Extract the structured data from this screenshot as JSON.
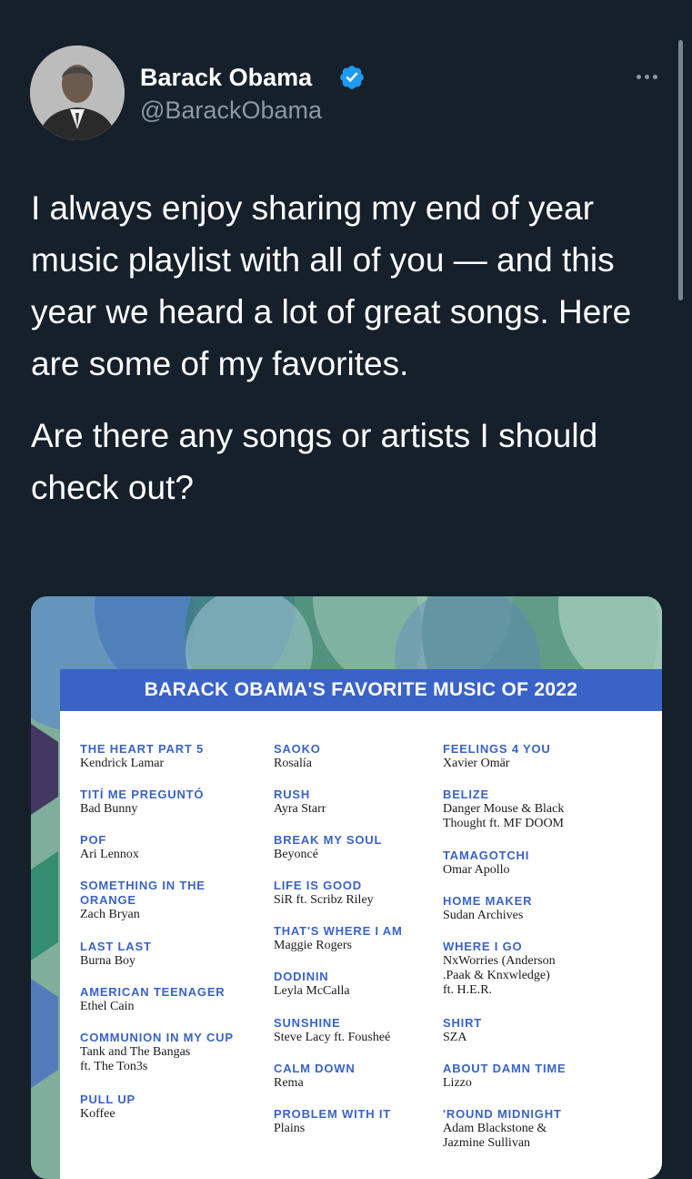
{
  "tweet": {
    "author": {
      "name": "Barack Obama",
      "handle": "@BarackObama",
      "verified": true
    },
    "paragraphs": [
      "I always enjoy sharing my end of year music playlist with all of you — and this year we heard a lot of great songs. Here are some of my favorites.",
      "Are there any songs or artists I should check out?"
    ],
    "more_icon": "more-horizontal-icon"
  },
  "image": {
    "title": "BARACK OBAMA'S FAVORITE MUSIC OF 2022",
    "columns": [
      [
        {
          "title": "THE HEART PART 5",
          "artist": "Kendrick Lamar"
        },
        {
          "title": "TITÍ ME PREGUNTÓ",
          "artist": "Bad Bunny"
        },
        {
          "title": "POF",
          "artist": "Ari Lennox"
        },
        {
          "title": "SOMETHING IN THE\nORANGE",
          "artist": "Zach Bryan"
        },
        {
          "title": "LAST LAST",
          "artist": "Burna Boy"
        },
        {
          "title": "AMERICAN TEENAGER",
          "artist": "Ethel Cain"
        },
        {
          "title": "COMMUNION IN MY CUP",
          "artist": "Tank and The Bangas\nft. The Ton3s"
        },
        {
          "title": "PULL UP",
          "artist": "Koffee"
        }
      ],
      [
        {
          "title": "SAOKO",
          "artist": "Rosalía"
        },
        {
          "title": "RUSH",
          "artist": "Ayra Starr"
        },
        {
          "title": "BREAK MY SOUL",
          "artist": "Beyoncé"
        },
        {
          "title": "LIFE IS GOOD",
          "artist": "SiR ft. Scribz Riley"
        },
        {
          "title": "THAT'S WHERE I AM",
          "artist": "Maggie Rogers"
        },
        {
          "title": "DODININ",
          "artist": "Leyla McCalla"
        },
        {
          "title": "SUNSHINE",
          "artist": "Steve Lacy ft. Fousheé"
        },
        {
          "title": "CALM DOWN",
          "artist": "Rema"
        },
        {
          "title": "PROBLEM WITH IT",
          "artist": "Plains"
        }
      ],
      [
        {
          "title": "FEELINGS 4 YOU",
          "artist": "Xavier Omär"
        },
        {
          "title": "BELIZE",
          "artist": "Danger Mouse & Black\nThought ft. MF DOOM"
        },
        {
          "title": "TAMAGOTCHI",
          "artist": "Omar Apollo"
        },
        {
          "title": "HOME MAKER",
          "artist": "Sudan Archives"
        },
        {
          "title": "WHERE I GO",
          "artist": "NxWorries (Anderson\n.Paak & Knxwledge)\nft. H.E.R."
        },
        {
          "title": "SHIRT",
          "artist": "SZA"
        },
        {
          "title": "ABOUT DAMN TIME",
          "artist": "Lizzo"
        },
        {
          "title": "'ROUND MIDNIGHT",
          "artist": "Adam Blackstone &\nJazmine Sullivan"
        }
      ]
    ]
  },
  "colors": {
    "background": "#15202b",
    "secondary_text": "#8b98a5",
    "verified": "#1d9bf0",
    "card_accent": "#3a63c7"
  }
}
